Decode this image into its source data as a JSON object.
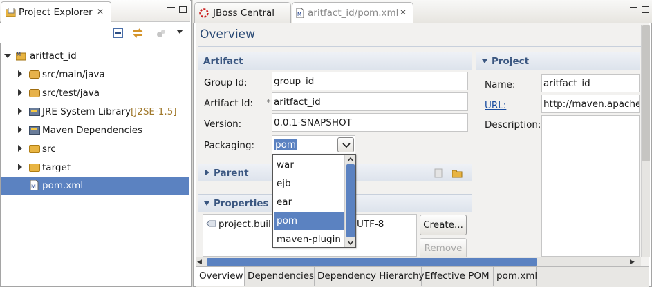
{
  "project_explorer": {
    "title": "Project Explorer",
    "tree": [
      {
        "label": "aritfact_id",
        "decoration": "",
        "expanded": true,
        "selected": false,
        "icon": "maven-project-icon"
      },
      {
        "label": "src/main/java",
        "decoration": "",
        "expanded": false,
        "selected": false,
        "icon": "package-folder-icon"
      },
      {
        "label": "src/test/java",
        "decoration": "",
        "expanded": false,
        "selected": false,
        "icon": "package-folder-icon"
      },
      {
        "label": "JRE System Library",
        "decoration": "[J2SE-1.5]",
        "expanded": false,
        "selected": false,
        "icon": "library-icon"
      },
      {
        "label": "Maven Dependencies",
        "decoration": "",
        "expanded": false,
        "selected": false,
        "icon": "library-icon"
      },
      {
        "label": "src",
        "decoration": "",
        "expanded": false,
        "selected": false,
        "icon": "folder-icon"
      },
      {
        "label": "target",
        "decoration": "",
        "expanded": false,
        "selected": false,
        "icon": "folder-icon"
      },
      {
        "label": "pom.xml",
        "decoration": "",
        "expanded": null,
        "selected": true,
        "icon": "pom-file-icon"
      }
    ]
  },
  "editor": {
    "tabs": [
      {
        "label": "JBoss Central",
        "active": false
      },
      {
        "label": "aritfact_id/pom.xml",
        "active": true
      }
    ],
    "title": "Overview",
    "artifact": {
      "section_title": "Artifact",
      "group_id_label": "Group Id:",
      "group_id_value": "group_id",
      "artifact_id_label": "Artifact Id:",
      "required_marker": "*",
      "artifact_id_value": "aritfact_id",
      "version_label": "Version:",
      "version_value": "0.0.1-SNAPSHOT",
      "packaging_label": "Packaging:",
      "packaging_value": "pom"
    },
    "packaging_dropdown": {
      "options": [
        "war",
        "ejb",
        "ear",
        "pom",
        "maven-plugin"
      ],
      "selected": "pom"
    },
    "parent": {
      "section_title": "Parent"
    },
    "properties": {
      "section_title": "Properties",
      "item_visible_left": "project.buil",
      "item_visible_right": "UTF-8",
      "create_button": "Create...",
      "remove_button": "Remove"
    },
    "project": {
      "section_title": "Project",
      "name_label": "Name:",
      "name_value": "aritfact_id",
      "url_label": "URL:",
      "url_value": "http://maven.apache.",
      "description_label": "Description:"
    },
    "bottom_tabs": [
      {
        "label": "Overview",
        "active": true
      },
      {
        "label": "Dependencies",
        "active": false
      },
      {
        "label": "Dependency Hierarchy",
        "active": false
      },
      {
        "label": "Effective POM",
        "active": false
      },
      {
        "label": "pom.xml",
        "active": false
      }
    ]
  },
  "colors": {
    "selection": "#5b82c1",
    "section_title": "#3b5781",
    "link": "#1a4da0"
  }
}
